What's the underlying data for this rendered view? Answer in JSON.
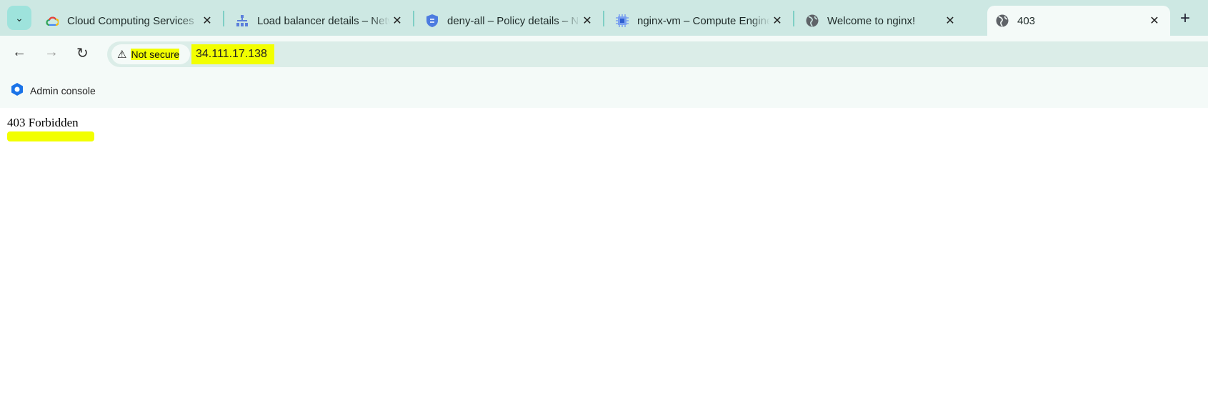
{
  "tabs": [
    {
      "label": "Cloud Computing Services",
      "icon": "google-cloud-icon"
    },
    {
      "label": "Load balancer details – Network",
      "icon": "load-balancer-icon"
    },
    {
      "label": "deny-all – Policy details – Network",
      "icon": "shield-icon"
    },
    {
      "label": "nginx-vm – Compute Engine",
      "icon": "chip-icon"
    },
    {
      "label": "Welcome to nginx!",
      "icon": "globe-icon"
    },
    {
      "label": "403",
      "icon": "globe-icon",
      "active": true
    }
  ],
  "address": {
    "security": "Not secure",
    "url": "34.111.17.138"
  },
  "bookmarks": [
    {
      "label": "Admin console"
    }
  ],
  "page": {
    "text": "403 Forbidden"
  },
  "colors": {
    "highlight": "#f2ff00",
    "tabbar": "#cde8e3"
  }
}
